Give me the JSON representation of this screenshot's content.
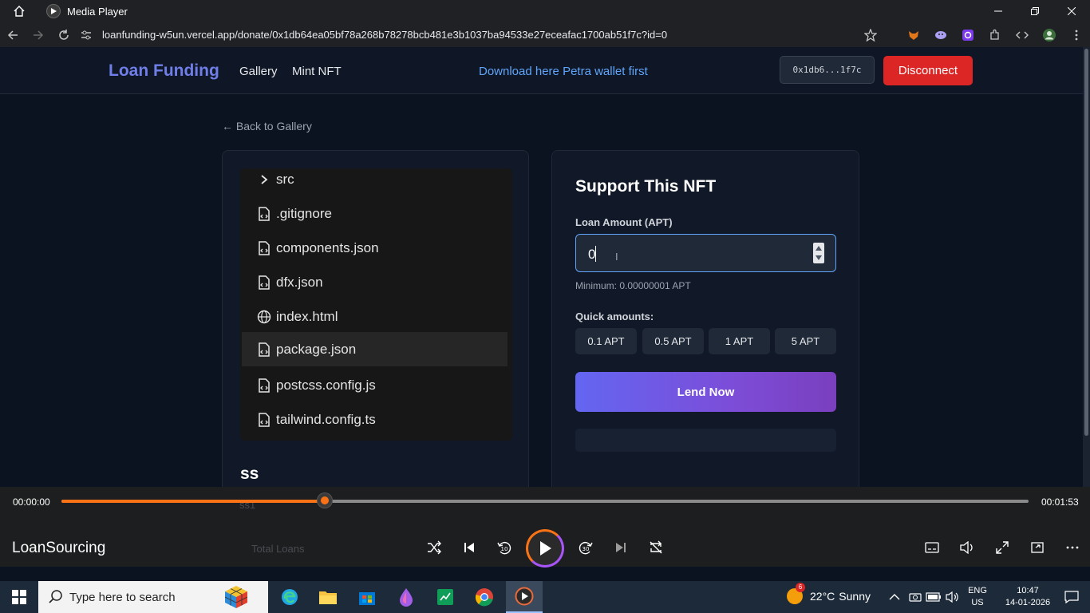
{
  "window": {
    "title": "Media Player",
    "controls": [
      "minimize",
      "restore",
      "close"
    ]
  },
  "browser": {
    "url": "loanfunding-w5un.vercel.app/donate/0x1db64ea05bf78a268b78278bcb481e3b1037ba94533e27eceafac1700ab51f7c?id=0"
  },
  "navbar": {
    "brand": "Loan Funding",
    "links": [
      "Gallery",
      "Mint NFT"
    ],
    "petra_link": "Download here Petra wallet first",
    "wallet_address": "0x1db6...1f7c",
    "disconnect": "Disconnect"
  },
  "back_link": "← Back to Gallery",
  "nft_card": {
    "files": [
      {
        "name": "src",
        "icon": "chevron-right-icon"
      },
      {
        "name": ".gitignore",
        "icon": "file-code-icon"
      },
      {
        "name": "components.json",
        "icon": "file-code-icon"
      },
      {
        "name": "dfx.json",
        "icon": "file-code-icon"
      },
      {
        "name": "index.html",
        "icon": "globe-icon"
      },
      {
        "name": "package.json",
        "icon": "file-code-icon",
        "selected": true
      },
      {
        "name": "postcss.config.js",
        "icon": "file-code-icon"
      },
      {
        "name": "tailwind.config.ts",
        "icon": "file-code-icon"
      }
    ],
    "title": "ss",
    "subtitle": "ss1",
    "total_loans_label": "Total Loans"
  },
  "support": {
    "heading": "Support This NFT",
    "amount_label": "Loan Amount (APT)",
    "amount_value": "0",
    "minimum": "Minimum: 0.00000001 APT",
    "quick_label": "Quick amounts:",
    "quick_amounts": [
      "0.1 APT",
      "0.5 APT",
      "1 APT",
      "5 APT"
    ],
    "lend_button": "Lend Now"
  },
  "media": {
    "current_time": "00:00:00",
    "total_time": "00:01:53",
    "progress_fraction": 0.272,
    "title": "LoanSourcing"
  },
  "taskbar": {
    "search_placeholder": "Type here to search",
    "weather_temp": "22°C",
    "weather_text": "Sunny",
    "weather_badge": "6",
    "lang_line1": "ENG",
    "lang_line2": "US",
    "time": "10:47",
    "date": "14-01-2026"
  },
  "colors": {
    "accent_brand": "#6f7ee8",
    "disconnect": "#dc2626",
    "link": "#60a5fa",
    "progress": "#f97316"
  }
}
